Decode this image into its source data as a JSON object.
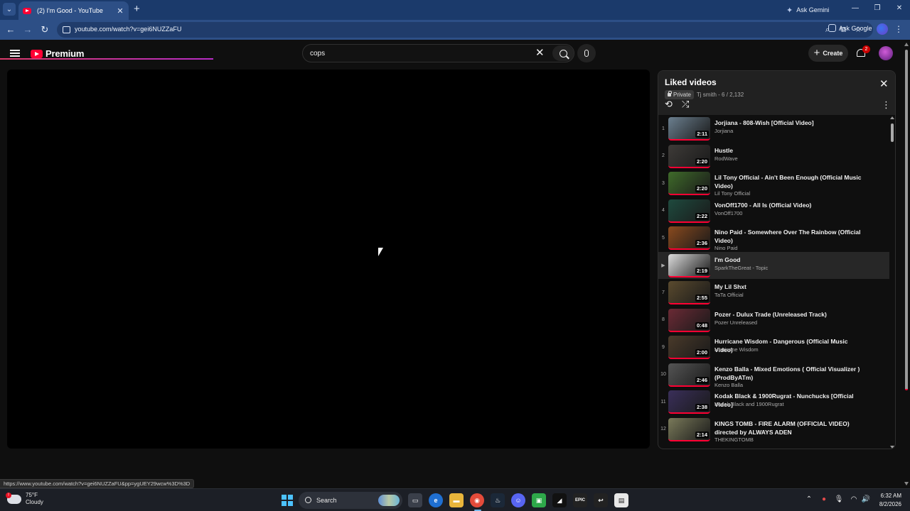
{
  "browser": {
    "tab_title": "(2) I'm Good - YouTube",
    "url": "youtube.com/watch?v=gei6NUZZaFU",
    "ask_gemini_label": "Ask Gemini",
    "ask_google_label": "Ask Google"
  },
  "masthead": {
    "logo_text": "Premium",
    "search_value": "cops",
    "create_label": "Create",
    "notification_count": "2"
  },
  "playlist": {
    "title": "Liked videos",
    "privacy_label": "Private",
    "owner_progress": "Tj smith - 6 / 2,132",
    "items": [
      {
        "index": "1",
        "title": "Jorjiana - 808-Wish [Official Video]",
        "channel": "Jorjiana",
        "duration": "2:11",
        "thumb_color": "#6b7f8f",
        "current": false
      },
      {
        "index": "2",
        "title": "Hustle",
        "channel": "RodWave",
        "duration": "2:20",
        "thumb_color": "#3e3b38",
        "current": false
      },
      {
        "index": "3",
        "title": "Lil Tony Official - Ain't Been Enough (Official Music Video)",
        "channel": "Lil Tony Official",
        "duration": "2:20",
        "thumb_color": "#3f6b2a",
        "current": false
      },
      {
        "index": "4",
        "title": "VonOff1700 - All Is (Official Video)",
        "channel": "VonOff1700",
        "duration": "2:22",
        "thumb_color": "#1e4a3e",
        "current": false
      },
      {
        "index": "5",
        "title": "Nino Paid - Somewhere Over The Rainbow (Official Video)",
        "channel": "Nino Paid",
        "duration": "2:36",
        "thumb_color": "#8a4a1e",
        "current": false
      },
      {
        "index": "▶",
        "title": "I'm Good",
        "channel": "SparkTheGreat - Topic",
        "duration": "2:19",
        "thumb_color": "#dcdcdc",
        "current": true
      },
      {
        "index": "7",
        "title": "My Lil Shxt",
        "channel": "TaTa Official",
        "duration": "2:55",
        "thumb_color": "#5a4a2e",
        "current": false
      },
      {
        "index": "8",
        "title": "Pozer - Dulux Trade (Unreleased Track)",
        "channel": "Pozer Unreleased",
        "duration": "0:48",
        "thumb_color": "#6b2a35",
        "current": false
      },
      {
        "index": "9",
        "title": "Hurricane Wisdom - Dangerous (Official Music Video)",
        "channel": "Hurricane Wisdom",
        "duration": "2:00",
        "thumb_color": "#4a3a2a",
        "current": false
      },
      {
        "index": "10",
        "title": "Kenzo Balla - Mixed Emotions ( Official Visualizer ) (ProdByATm)",
        "channel": "Kenzo Balla",
        "duration": "2:46",
        "thumb_color": "#555555",
        "current": false
      },
      {
        "index": "11",
        "title": "Kodak Black & 1900Rugrat - Nunchucks [Official Video]",
        "channel": "Kodak Black and 1900Rugrat",
        "duration": "2:38",
        "thumb_color": "#3a2f5a",
        "current": false
      },
      {
        "index": "12",
        "title": "KINGS TOMB - FIRE ALARM (OFFICIAL VIDEO) directed by ALWAYS ADEN",
        "channel": "THEKINGTOMB",
        "duration": "2:14",
        "thumb_color": "#7a7a5a",
        "current": false
      }
    ]
  },
  "status_url": "https://www.youtube.com/watch?v=gei6NUZZaFU&pp=ygUEY29wcw%3D%3D",
  "taskbar": {
    "weather_temp": "75°F",
    "weather_desc": "Cloudy",
    "search_label": "Search",
    "time": "6:32 AM",
    "date": "8/2/2026"
  }
}
